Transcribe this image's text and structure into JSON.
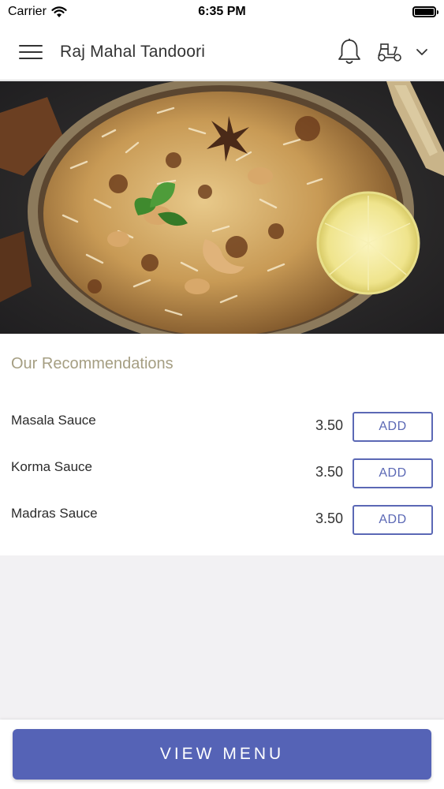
{
  "status_bar": {
    "carrier": "Carrier",
    "time": "6:35 PM",
    "battery_level_percent": 100
  },
  "header": {
    "title": "Raj Mahal Tandoori",
    "icons": [
      "menu-icon",
      "bell-icon",
      "scooter-icon",
      "chevron-down-icon"
    ]
  },
  "hero": {
    "image": "biryani-dish-photo"
  },
  "recommendations": {
    "title": "Our Recommendations",
    "items": [
      {
        "name": "Masala Sauce",
        "price": "3.50",
        "button": "ADD"
      },
      {
        "name": "Korma Sauce",
        "price": "3.50",
        "button": "ADD"
      },
      {
        "name": "Madras Sauce",
        "price": "3.50",
        "button": "ADD"
      }
    ]
  },
  "footer": {
    "view_menu_label": "VIEW MENU"
  },
  "colors": {
    "accent": "#5563b6",
    "section_title": "#a59e82",
    "background": "#f2f1f3"
  }
}
